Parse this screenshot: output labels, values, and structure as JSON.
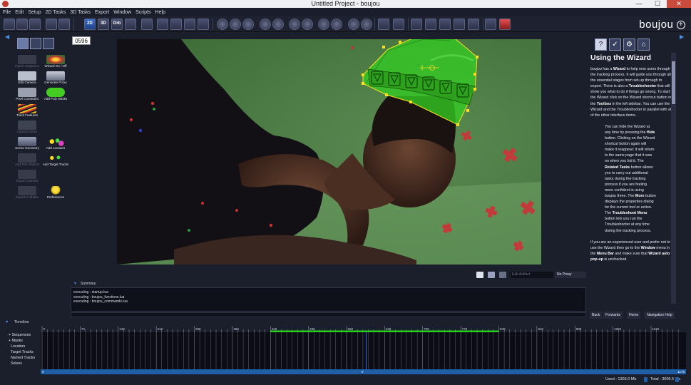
{
  "window": {
    "title": "Untitled Project - boujou",
    "min": "—",
    "max": "☐",
    "close": "✕"
  },
  "menu": [
    "File",
    "Edit",
    "Setup",
    "2D Tasks",
    "3D Tasks",
    "Export",
    "Window",
    "Scripts",
    "Help"
  ],
  "logo": {
    "text": "boujou",
    "symbol": "+"
  },
  "frame_counter": "0596",
  "toolbox": {
    "tools": [
      {
        "label": "Import Sequence",
        "enabled": false,
        "icon": "film-import-icon"
      },
      {
        "label": "Wizard On / Off",
        "enabled": true,
        "icon": "wizard-icon"
      },
      {
        "label": "Edit Camera",
        "enabled": true,
        "icon": "camera-icon"
      },
      {
        "label": "Generate Proxy",
        "enabled": true,
        "icon": "proxy-icon"
      },
      {
        "label": "Pixel Constraint",
        "enabled": true,
        "icon": "pixel-constraint-icon"
      },
      {
        "label": "Add Poly Masks",
        "enabled": true,
        "icon": "poly-mask-icon"
      },
      {
        "label": "Track Features",
        "enabled": true,
        "icon": "track-features-icon"
      },
      {
        "label": "Camera Solve",
        "enabled": false,
        "icon": "camera-solve-icon"
      },
      {
        "label": "Scene Geometry",
        "enabled": true,
        "icon": "scene-geometry-icon"
      },
      {
        "label": "Add Locators",
        "enabled": true,
        "icon": "locators-icon"
      },
      {
        "label": "Add Test Objects",
        "enabled": false,
        "icon": "test-objects-icon"
      },
      {
        "label": "Add Target Tracks",
        "enabled": true,
        "icon": "target-tracks-icon"
      },
      {
        "label": "Export Camera",
        "enabled": false,
        "icon": "export-camera-icon"
      },
      {
        "label": "Export to Shake",
        "enabled": false,
        "icon": "export-shake-icon"
      },
      {
        "label": "Preferences",
        "enabled": true,
        "icon": "preferences-icon"
      }
    ]
  },
  "viewport_footer": {
    "edit_artifact": "Edit Artifact",
    "no_proxy": "No Proxy"
  },
  "summary": {
    "title": "Summary",
    "lines": [
      "executing : startup.lua",
      "executing : boujou_functions.lua",
      "executing : boujou_commands.lua"
    ]
  },
  "help": {
    "tab_icons": [
      "question-icon",
      "troubleshooter-icon",
      "related-tasks-icon",
      "more-icon"
    ],
    "title": "Using the Wizard",
    "intro": [
      {
        "t": "boujou",
        "s": "i"
      },
      {
        "t": " has a "
      },
      {
        "t": "Wizard",
        "s": "b"
      },
      {
        "t": " to help new users through the tracking process. It will guide you through all the essential stages from set-up through to export. There is also a "
      },
      {
        "t": "Troubleshooter",
        "s": "b"
      },
      {
        "t": " that will show you what to do if things go wrong. To start the Wizard click on the Wizard shortcut button in the "
      },
      {
        "t": "Toolbox",
        "s": "b"
      },
      {
        "t": " in the left sidebar. You can use the Wizard and the Troubleshooter in parallel with all of the other interface items."
      }
    ],
    "indent": [
      {
        "t": "You can hide the Wizard at any time by pressing the "
      },
      {
        "t": "Hide",
        "s": "b"
      },
      {
        "t": " button. Clicking on the Wizard shortcut button again will make it reappear; it will return to the same page that it was on when you hid it. The "
      },
      {
        "t": "Related Tasks",
        "s": "b"
      },
      {
        "t": " button allows you to carry out additional tasks during the tracking process if you are feeling more confident in using "
      },
      {
        "t": "boujou",
        "s": "i"
      },
      {
        "t": " three. The "
      },
      {
        "t": "More",
        "s": "b"
      },
      {
        "t": " button displays the properties dialog for the current tool or action. The "
      },
      {
        "t": "Troubleshoot Menu",
        "s": "b"
      },
      {
        "t": " button lets you run the Troubleshooter at any time during the tracking process."
      }
    ],
    "outro": [
      {
        "t": "If you are an experienced user and prefer not to use the Wizard then go to the "
      },
      {
        "t": "Window",
        "s": "b"
      },
      {
        "t": " menu in the "
      },
      {
        "t": "Menu Bar",
        "s": "b"
      },
      {
        "t": " and make sure that "
      },
      {
        "t": "Wizard auto pop-up",
        "s": "b"
      },
      {
        "t": " is unchecked."
      }
    ],
    "nav": [
      "Back",
      "Forwards",
      "Home",
      "Navigation Help"
    ]
  },
  "timeline": {
    "title": "Timeline",
    "tracks": [
      "Sequences",
      "Masks",
      "Locators",
      "Target Tracks",
      "Named Tracks",
      "Solves"
    ],
    "ticks": [
      "0",
      "70",
      "140",
      "210",
      "280",
      "350",
      "420",
      "490",
      "560",
      "630",
      "700",
      "770",
      "840",
      "910",
      "980",
      "1050",
      "1120"
    ],
    "frame_start": "0",
    "frame_end": "1179",
    "active_range": [
      420,
      840
    ]
  },
  "status": {
    "used": "Used : 1305.0 Mb",
    "total": "Total : 3006.5 Mb"
  },
  "colors": {
    "accent": "#4a8fe0",
    "mask_fill": "#33cc22",
    "mask_handle": "#ffe020",
    "timeline_active": "#28d020",
    "scrub": "#1f5fa8"
  }
}
